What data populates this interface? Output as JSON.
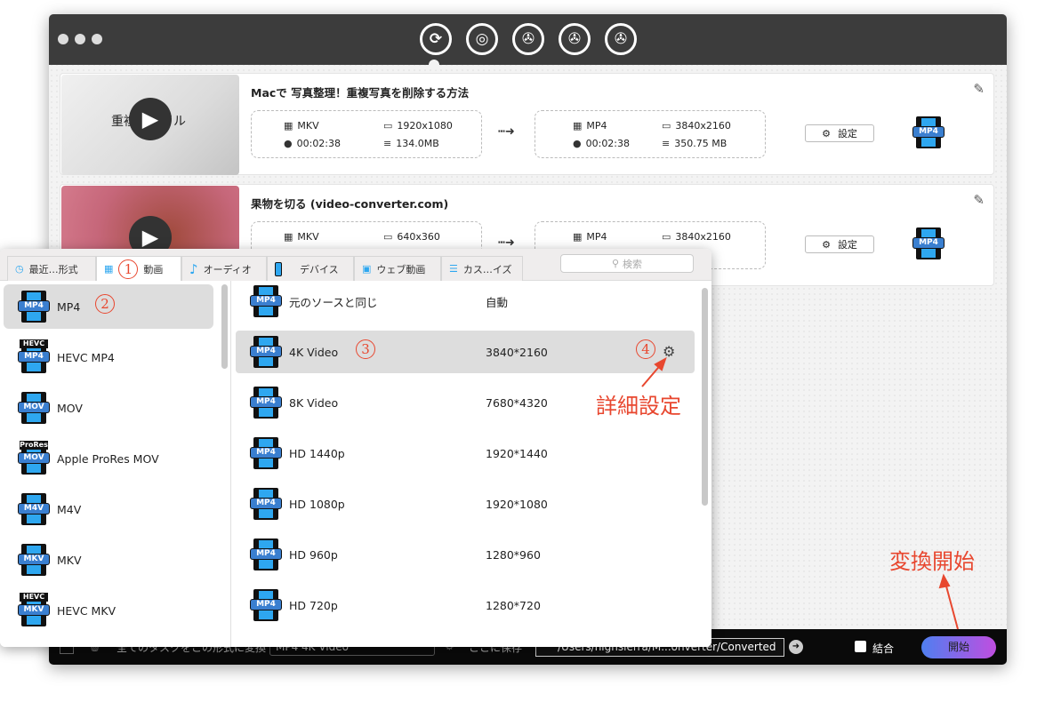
{
  "toolbar": {
    "icons": [
      "convert-icon",
      "rip-dvd-icon",
      "download-icon",
      "edit-icon",
      "toolbox-icon"
    ]
  },
  "tasks": [
    {
      "title": "Macで 写真整理！重複写真を削除する方法",
      "src": {
        "format": "MKV",
        "resolution": "1920x1080",
        "duration": "00:02:38",
        "size": "134.0MB"
      },
      "dst": {
        "format": "MP4",
        "resolution": "3840x2160",
        "duration": "00:02:38",
        "size": "350.75 MB"
      },
      "settings_label": "設定",
      "badge": "MP4",
      "thumb_text": "重複ファイル"
    },
    {
      "title": "果物を切る (video-converter.com)",
      "src": {
        "format": "MKV",
        "resolution": "640x360"
      },
      "dst": {
        "format": "MP4",
        "resolution": "3840x2160"
      },
      "settings_label": "設定",
      "badge": "MP4"
    }
  ],
  "popup": {
    "tabs": [
      "最近…形式",
      "動画",
      "オーディオ",
      "デバイス",
      "ウェブ動画",
      "カス…イズ"
    ],
    "search_placeholder": "検索",
    "formats": [
      {
        "label": "MP4",
        "badge": "MP4"
      },
      {
        "label": "HEVC MP4",
        "badge": "MP4",
        "top": "HEVC"
      },
      {
        "label": "MOV",
        "badge": "MOV"
      },
      {
        "label": "Apple ProRes MOV",
        "badge": "MOV",
        "top": "ProRes"
      },
      {
        "label": "M4V",
        "badge": "M4V"
      },
      {
        "label": "MKV",
        "badge": "MKV"
      },
      {
        "label": "HEVC MKV",
        "badge": "MKV",
        "top": "HEVC"
      }
    ],
    "presets": [
      {
        "label": "元のソースと同じ",
        "res": "自動"
      },
      {
        "label": "4K Video",
        "res": "3840*2160"
      },
      {
        "label": "8K Video",
        "res": "7680*4320"
      },
      {
        "label": "HD 1440p",
        "res": "1920*1440"
      },
      {
        "label": "HD 1080p",
        "res": "1920*1080"
      },
      {
        "label": "HD 960p",
        "res": "1280*960"
      },
      {
        "label": "HD 720p",
        "res": "1280*720"
      }
    ]
  },
  "bottom": {
    "convert_all_label": "全てのタスクをこの形式に変換",
    "format_value": "MP4 4K Video",
    "save_label": "ここに保存",
    "path": "/Users/highsierra/M...onverter/Converted",
    "merge_label": "結合",
    "start_label": "開始"
  },
  "annotations": {
    "n1": "1",
    "n2": "2",
    "n3": "3",
    "n4": "4",
    "detail": "詳細設定",
    "start": "変換開始"
  },
  "colors": {
    "annotation": "#e8472f",
    "accent": "#2ea7f0"
  }
}
